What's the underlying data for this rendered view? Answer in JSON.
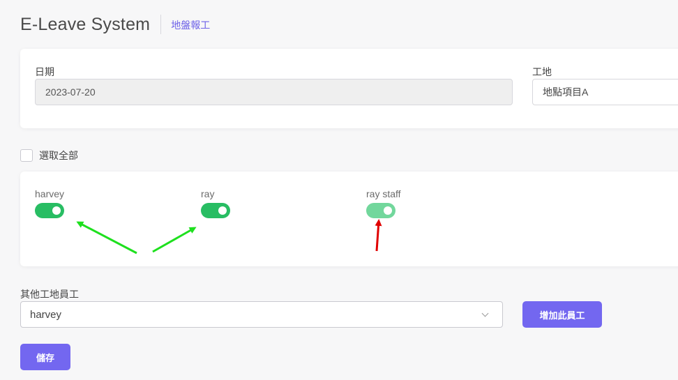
{
  "header": {
    "title": "E-Leave System",
    "subtitle": "地盤報工"
  },
  "form": {
    "date_label": "日期",
    "date_value": "2023-07-20",
    "site_label": "工地",
    "site_value": "地點項目A"
  },
  "select_all": {
    "label": "選取全部",
    "checked": false
  },
  "workers": [
    {
      "name": "harvey",
      "on": true
    },
    {
      "name": "ray",
      "on": true
    },
    {
      "name": "ray staff",
      "on": true,
      "dimmed": true
    }
  ],
  "other_staff": {
    "label": "其他工地員工",
    "selected": "harvey",
    "add_button": "增加此員工"
  },
  "save_button": "儲存",
  "colors": {
    "accent": "#7367f0",
    "toggle_on": "#28bd63",
    "toggle_dim": "#72d79c",
    "arrow_green": "#1ee01e",
    "arrow_red": "#e00000"
  }
}
